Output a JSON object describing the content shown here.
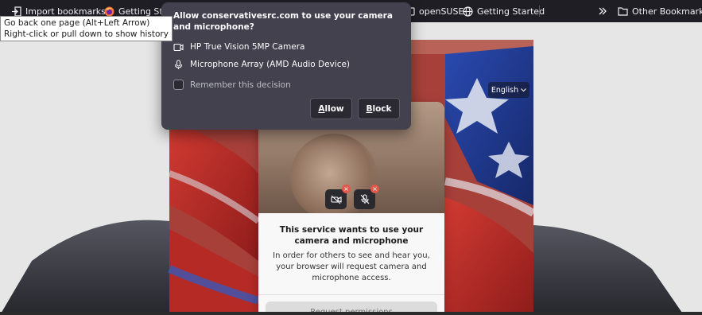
{
  "bookmarks_bar": {
    "items": [
      {
        "label": "Import bookmarks...",
        "icon": "import-icon"
      },
      {
        "label": "Getting Start",
        "icon": "firefox-icon"
      },
      {
        "label": "openSUSE",
        "icon": "folder-icon"
      },
      {
        "label": "Getting Started",
        "icon": "globe-icon"
      }
    ],
    "overflow_icon": "double-chevron-icon",
    "other_bookmarks": "Other Bookmarks"
  },
  "tooltip": {
    "line1": "Go back one page (Alt+Left Arrow)",
    "line2": "Right-click or pull down to show history"
  },
  "permission_popup": {
    "title": "Allow conservativesrc.com to use your camera and microphone?",
    "camera": "HP True Vision 5MP Camera",
    "microphone": "Microphone Array (AMD Audio Device)",
    "remember": "Remember this decision",
    "allow_label": "Allow",
    "allow_accesskey": "A",
    "block_label": "Block",
    "block_accesskey": "B"
  },
  "page": {
    "language": "English",
    "card": {
      "title": "This service wants to use your camera and microphone",
      "text": "In order for others to see and hear you, your browser will request camera and microphone access.",
      "button": "Request permissions"
    }
  },
  "colors": {
    "popup_bg": "#42414d",
    "toolbar_bg": "#1f1e25",
    "flag_red": "#c6302b",
    "flag_blue": "#1d3a8f"
  }
}
